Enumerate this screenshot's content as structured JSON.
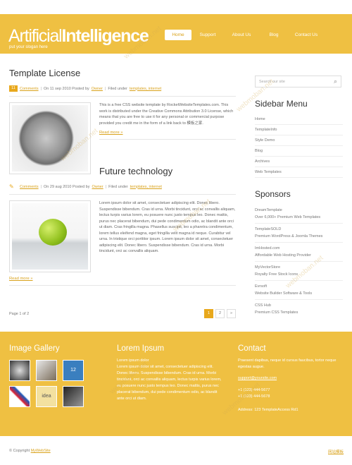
{
  "header": {
    "logo_thin": "Artificial",
    "logo_bold": "Intelligence",
    "slogan": "put your slogan here",
    "nav": [
      "Home",
      "Support",
      "About Us",
      "Blog",
      "Contact Us"
    ]
  },
  "posts": [
    {
      "title": "Template License",
      "comments_count": "11",
      "comments_label": "Comments",
      "date": "On 11 sep 2010 Posted by",
      "author": "Owner",
      "filed": "Filed under",
      "tags": "templates, internet",
      "body": "This is a free CSS website template by RocketWebsiteTemplates.com. This work is distributed under the Creative Commons Attribution 3.0 License, which means that you are free to use it for any personal or commercial purpose provided you credit me in the form of a link back to 模板之家.",
      "more": "Read more »"
    },
    {
      "title": "Future technology",
      "comments_label": "Comments",
      "date": "On 29 aug 2010 Posted by",
      "author": "Owner",
      "filed": "Filed under",
      "tags": "templates, internet",
      "body": "Lorem ipsum dolor sit amet, consectetuer adipiscing elit. Donec libero. Suspendisse bibendum. Cras id urna. Morbi tincidunt, orci ac convallis aliquam, lectus turpis varius lorem, eu posuere nunc justo tempus leo. Donec mattis, purus nec placerat bibendum, dui pede condimentum odio, ac blandit ante orci ut diam. Cras fringilla magna. Phasellus suscipit, leo a pharetra condimentum, lorem tellus eleifend magna, eget fringilla velit magna id neque. Curabitur vel urna. In tristique orci porttitor ipsum. Lorem ipsum dolor sit amet, consectetuer adipiscing elit. Donec libero. Suspendisse bibendum. Cras id urna. Morbi tincidunt, orci ac convallis aliquam.",
      "more": "Read more »"
    }
  ],
  "pager": {
    "info": "Page 1 of 2",
    "pages": [
      "1",
      "2",
      "»"
    ]
  },
  "sidebar": {
    "search_placeholder": "Search our site",
    "menu_title": "Sidebar Menu",
    "menu": [
      "Home",
      "TemplateInfo",
      "Style Demo",
      "Blog",
      "Archives",
      "Web Templates"
    ],
    "sponsors_title": "Sponsors",
    "sponsors": [
      {
        "name": "DreamTemplate",
        "desc": "Over 6,000+ Premium Web Templates"
      },
      {
        "name": "TemplateSOLD",
        "desc": "Premium WordPress & Joomla Themes"
      },
      {
        "name": "ImHosted.com",
        "desc": "Affordable Web Hosting Provider"
      },
      {
        "name": "MyVectorStore",
        "desc": "Royalty Free Stock Icons"
      },
      {
        "name": "Evrsoft",
        "desc": "Website Builder Software & Tools"
      },
      {
        "name": "CSS Hub",
        "desc": "Premium CSS Templates"
      }
    ]
  },
  "footer": {
    "gallery_title": "Image Gallery",
    "gallery_thumb_3": "12",
    "gallery_thumb_5": "idea",
    "lorem_title": "Lorem Ipsum",
    "lorem_text": "Lorem ipsum dolor\nLorem ipsum dolor sit amet, consectetuer adipiscing elit. Donec libero. Suspendisse bibendum. Cras id urna. Morbi tincidunt, orci ac convallis aliquam, lectus turpis varius lorem, eu posuere nunc justo tempus leo. Donec mattis, purus nec placerat bibendum, dui pede condimentum odio, ac blandit ante orci ut diam.",
    "contact_title": "Contact",
    "contact_text": "Praesent dapibus, neque id cursus faucibus, tortor neque egestas augue.",
    "email": "support@yoursite.com",
    "phone1": "+1 (123) 444-5677",
    "phone2": "+1 (123) 444-5678",
    "address": "Address: 123 TemplateAccess Rd1"
  },
  "bottom": {
    "copyright": "© Copyright",
    "site": "MyWebSite",
    "credit": "网站模板"
  },
  "watermark": "webmoban.net"
}
